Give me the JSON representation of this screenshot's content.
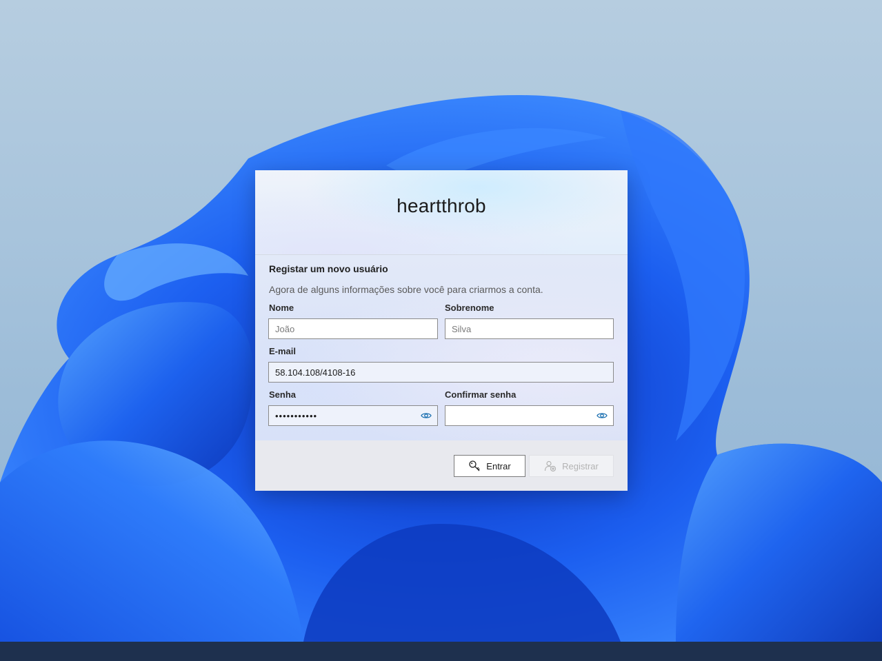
{
  "app": {
    "title": "heartthrob"
  },
  "form": {
    "section_title": "Registar um novo usuário",
    "section_description": "Agora de alguns informações sobre você para criarmos a conta.",
    "fields": {
      "first_name": {
        "label": "Nome",
        "value": "",
        "placeholder": "João"
      },
      "last_name": {
        "label": "Sobrenome",
        "value": "",
        "placeholder": "Silva"
      },
      "email": {
        "label": "E-mail",
        "value": "58.104.108/4108-16",
        "placeholder": ""
      },
      "password": {
        "label": "Senha",
        "value": "•••••••••••",
        "placeholder": ""
      },
      "confirm_password": {
        "label": "Confirmar senha",
        "value": "",
        "placeholder": ""
      }
    }
  },
  "footer": {
    "enter_label": "Entrar",
    "register_label": "Registrar",
    "register_enabled": false
  },
  "icons": {
    "enter": "key-icon",
    "register": "add-user-icon",
    "password_toggle": "eye-icon"
  },
  "colors": {
    "accent": "#1a6fb0",
    "wallpaper_blue": "#1a5fe6"
  }
}
